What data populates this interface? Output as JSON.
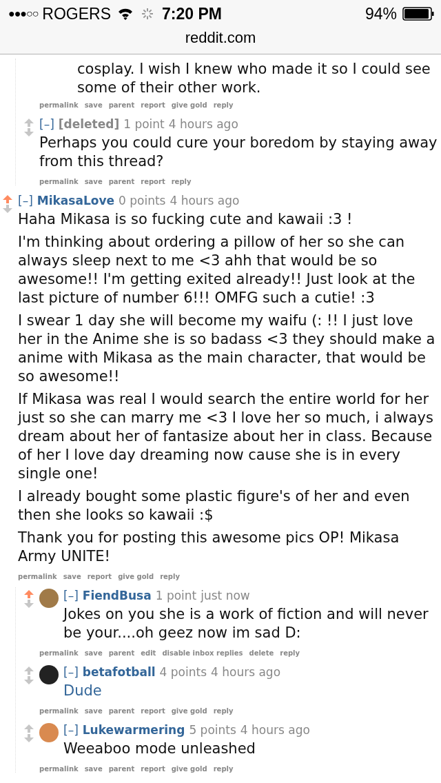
{
  "status_bar": {
    "signal_dots": "●●●○○",
    "carrier": "ROGERS",
    "time": "7:20 PM",
    "battery": "94%"
  },
  "url_bar": {
    "domain": "reddit.com"
  },
  "threads": [
    {
      "kind": "stub",
      "children": [
        {
          "kind": "partial",
          "body": [
            {
              "kind": "text",
              "text": "cosplay. I wish I knew who made it so I could see some of their other work."
            }
          ],
          "actions": [
            "permalink",
            "save",
            "parent",
            "report",
            "give gold",
            "reply"
          ]
        },
        {
          "kind": "comment",
          "upvoted": false,
          "deleted": true,
          "toggle": "[–]",
          "author": "[deleted]",
          "score": "1 point",
          "time": "4 hours ago",
          "body": [
            {
              "kind": "text",
              "text": "Perhaps you could cure your boredom by staying away from this thread?"
            }
          ],
          "actions": [
            "permalink",
            "save",
            "parent",
            "report",
            "reply"
          ]
        }
      ]
    },
    {
      "kind": "comment",
      "upvoted": true,
      "deleted": false,
      "toggle": "[–]",
      "author": "MikasaLove",
      "score": "0 points",
      "time": "4 hours ago",
      "body": [
        {
          "kind": "text",
          "text": "Haha Mikasa is so fucking cute and kawaii :3 !"
        },
        {
          "kind": "text",
          "text": "I'm thinking about ordering a pillow of her so she can always sleep next to me <3 ahh that would be so awesome!! I'm getting exited already!! Just look at the last picture of number 6!!! OMFG such a cutie! :3"
        },
        {
          "kind": "text",
          "text": "I swear 1 day she will become my waifu (: !! I just love her in the Anime she is so badass <3 they should make a anime with Mikasa as the main character, that would be so awesome!!"
        },
        {
          "kind": "text",
          "text": "If Mikasa was real I would search the entire world for her just so she can marry me <3 I love her so much, i always dream about her of fantasize about her in class. Because of her I love day dreaming now cause she is in every single one!"
        },
        {
          "kind": "text",
          "text": "I already bought some plastic figure's of her and even then she looks so kawaii :$"
        },
        {
          "kind": "text",
          "text": "Thank you for posting this awesome pics OP! Mikasa Army UNITE!"
        }
      ],
      "actions": [
        "permalink",
        "save",
        "report",
        "give gold",
        "reply"
      ],
      "children": [
        {
          "kind": "comment",
          "upvoted": true,
          "deleted": false,
          "avatar": true,
          "toggle": "[–]",
          "author": "FiendBusa",
          "score": "1 point",
          "time": "just now",
          "body": [
            {
              "kind": "text",
              "text": "Jokes on you she is a work of fiction and will never be your....oh geez now im sad D:"
            }
          ],
          "actions": [
            "permalink",
            "save",
            "parent",
            "edit",
            "disable inbox replies",
            "delete",
            "reply"
          ]
        },
        {
          "kind": "comment",
          "upvoted": false,
          "deleted": false,
          "avatar": true,
          "toggle": "[–]",
          "author": "betafotball",
          "score": "4 points",
          "time": "4 hours ago",
          "body": [
            {
              "kind": "link",
              "text": "Dude"
            }
          ],
          "actions": [
            "permalink",
            "save",
            "parent",
            "report",
            "give gold",
            "reply"
          ]
        },
        {
          "kind": "comment",
          "upvoted": false,
          "deleted": false,
          "avatar": true,
          "toggle": "[–]",
          "author": "Lukewarmering",
          "score": "5 points",
          "time": "4 hours ago",
          "body": [
            {
              "kind": "text",
              "text": "Weeaboo mode unleashed"
            }
          ],
          "actions": [
            "permalink",
            "save",
            "parent",
            "report",
            "give gold",
            "reply"
          ]
        }
      ]
    }
  ]
}
